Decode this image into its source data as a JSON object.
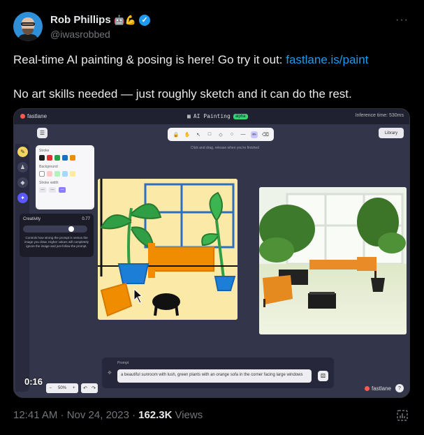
{
  "author": {
    "display_name": "Rob Phillips",
    "emoji": "🤖💪",
    "handle": "@iwasrobbed",
    "verified_mark": "✓"
  },
  "more_icon": "···",
  "tweet": {
    "text_line1": "Real-time AI painting & posing is here! Go try it out: ",
    "link": "fastlane.is/paint",
    "text_line2": "No art skills needed — just roughly sketch and it can do the rest."
  },
  "media": {
    "app_logo": "fastlane",
    "app_title": "AI Painting",
    "alpha_badge": "alpha",
    "inference_label": "Inference time: 530ms",
    "library_label": "Library",
    "hint": "Click and drag, release when you're finished",
    "stroke_label": "Stroke",
    "background_label": "Background",
    "stroke_width_label": "Stroke width",
    "stroke_colors": [
      "#1e1e1e",
      "#e03131",
      "#2f9e44",
      "#1971c2",
      "#f08c00"
    ],
    "background_colors": [
      "#ffffff",
      "#ffc9c9",
      "#b2f2bb",
      "#a5d8ff",
      "#ffec99"
    ],
    "stroke_widths": [
      "—",
      "—",
      "—"
    ],
    "creativity_label": "Creativity",
    "creativity_value": "0.77",
    "creativity_level": 0.77,
    "creativity_desc": "Controls how strong the prompt is versus the image you draw. Higher values will completely ignore the image and just follow the prompt.",
    "prompt_label": "Prompt",
    "prompt_text": "a beautiful sunroom with lush, green plants with an orange sofa in the corner facing large windows",
    "video_time": "0:16",
    "zoom_value": "50%",
    "zoom_minus": "−",
    "zoom_plus": "+",
    "undo": "↶",
    "redo": "↷",
    "brand_label": "fastlane",
    "help": "?"
  },
  "footer": {
    "timestamp": "12:41 AM · Nov 24, 2023 · ",
    "views_count": "162.3K",
    "views_label": "Views"
  },
  "colors": {
    "accent": "#1d9bf0",
    "app_bg": "#33354a",
    "sketch_bg": "#fbe9a8"
  }
}
